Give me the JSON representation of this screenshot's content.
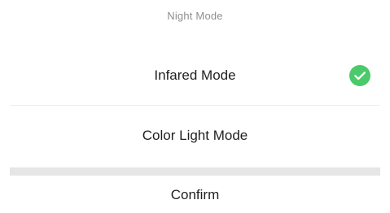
{
  "sheet": {
    "title": "Night Mode",
    "options": [
      {
        "label": "Infared Mode",
        "selected": true,
        "icon": "check-circle-icon"
      },
      {
        "label": "Color Light Mode",
        "selected": false
      }
    ],
    "confirm_label": "Confirm"
  },
  "colors": {
    "accent_green": "#4cc96a"
  }
}
